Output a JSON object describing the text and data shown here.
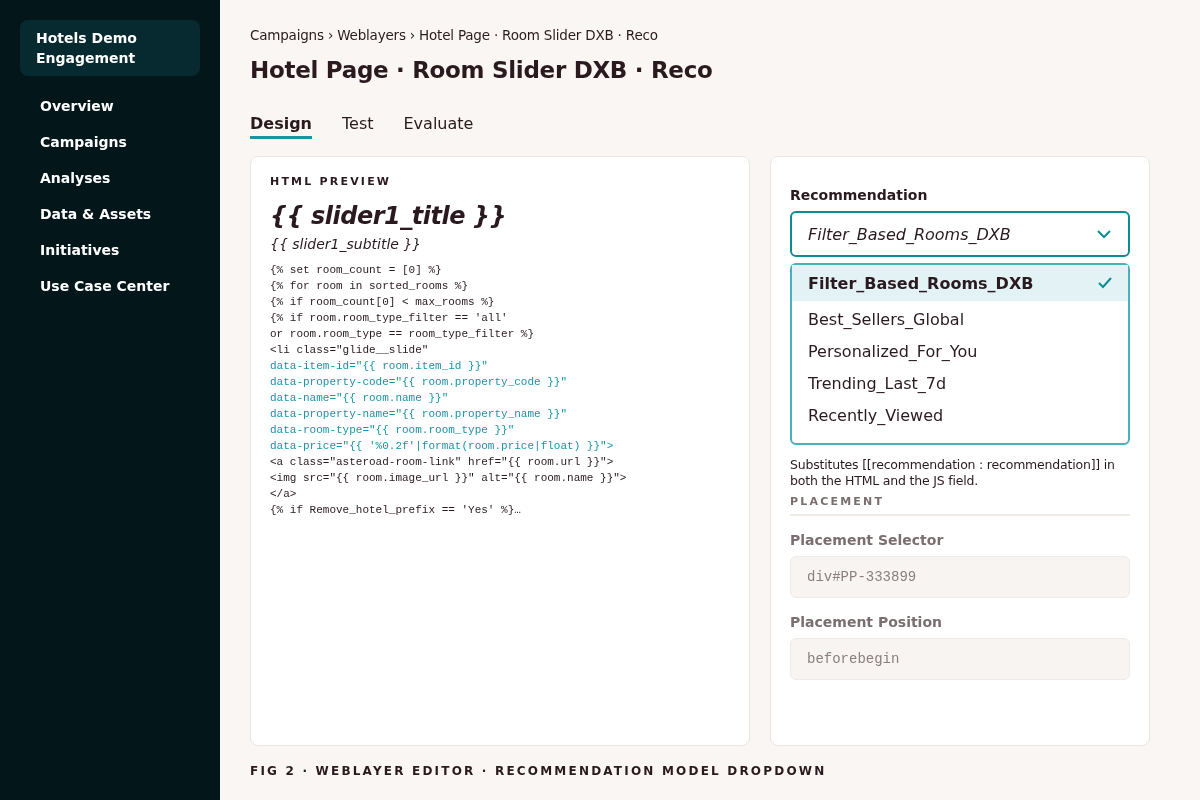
{
  "sidebar": {
    "workspace": "Hotels Demo Engagement",
    "items": [
      {
        "label": "Overview"
      },
      {
        "label": "Campaigns"
      },
      {
        "label": "Analyses"
      },
      {
        "label": "Data & Assets"
      },
      {
        "label": "Initiatives"
      },
      {
        "label": "Use Case Center"
      }
    ]
  },
  "breadcrumb": "Campaigns › Weblayers › Hotel Page · Room Slider DXB · Reco",
  "title": "Hotel Page · Room Slider DXB · Reco",
  "tabs": [
    {
      "label": "Design",
      "selected": true
    },
    {
      "label": "Test",
      "selected": false
    },
    {
      "label": "Evaluate",
      "selected": false
    }
  ],
  "preview": {
    "heading": "HTML PREVIEW",
    "slider_title": "{{ slider1_title }}",
    "slider_subtitle": "{{ slider1_subtitle }}",
    "code_lines": [
      {
        "kind": "code",
        "text": "{% set room_count = [0] %}"
      },
      {
        "kind": "code",
        "text": "{% for room in sorted_rooms %}"
      },
      {
        "kind": "code",
        "text": "{% if room_count[0] < max_rooms %}"
      },
      {
        "kind": "code",
        "text": "{% if room.room_type_filter == 'all'"
      },
      {
        "kind": "code",
        "text": "or room.room_type == room_type_filter %}"
      },
      {
        "kind": "code",
        "text": "<li class=\"glide__slide\""
      },
      {
        "kind": "attr",
        "text": "data-item-id=\"{{ room.item_id }}\""
      },
      {
        "kind": "attr",
        "text": "data-property-code=\"{{ room.property_code }}\""
      },
      {
        "kind": "attr",
        "text": "data-name=\"{{ room.name }}\""
      },
      {
        "kind": "attr",
        "text": "data-property-name=\"{{ room.property_name }}\""
      },
      {
        "kind": "attr",
        "text": "data-room-type=\"{{ room.room_type }}\""
      },
      {
        "kind": "attr",
        "text": "data-price=\"{{ '%0.2f'|format(room.price|float) }}\">"
      },
      {
        "kind": "code",
        "text": "<a class=\"asteroad-room-link\" href=\"{{ room.url }}\">"
      },
      {
        "kind": "code",
        "text": "<img src=\"{{ room.image_url }}\" alt=\"{{ room.name }}\">"
      },
      {
        "kind": "code",
        "text": "</a>"
      },
      {
        "kind": "code",
        "text": "{% if Remove_hotel_prefix == 'Yes' %}…"
      }
    ]
  },
  "recommendation": {
    "label": "Recommendation",
    "value": "Filter_Based_Rooms_DXB",
    "expanded": true,
    "options": [
      {
        "label": "Filter_Based_Rooms_DXB",
        "selected": true
      },
      {
        "label": "Best_Sellers_Global",
        "selected": false
      },
      {
        "label": "Personalized_For_You",
        "selected": false
      },
      {
        "label": "Trending_Last_7d",
        "selected": false
      },
      {
        "label": "Recently_Viewed",
        "selected": false
      }
    ],
    "help": "Substitutes [[recommendation : recommendation]] in both the HTML and the JS field."
  },
  "placement": {
    "heading": "PLACEMENT",
    "fields": [
      {
        "label": "Placement Selector",
        "value": "div#PP-333899"
      },
      {
        "label": "Placement Position",
        "value": "beforebegin"
      }
    ]
  },
  "caption": "FIG 2 · WEBLAYER EDITOR · RECOMMENDATION MODEL DROPDOWN"
}
